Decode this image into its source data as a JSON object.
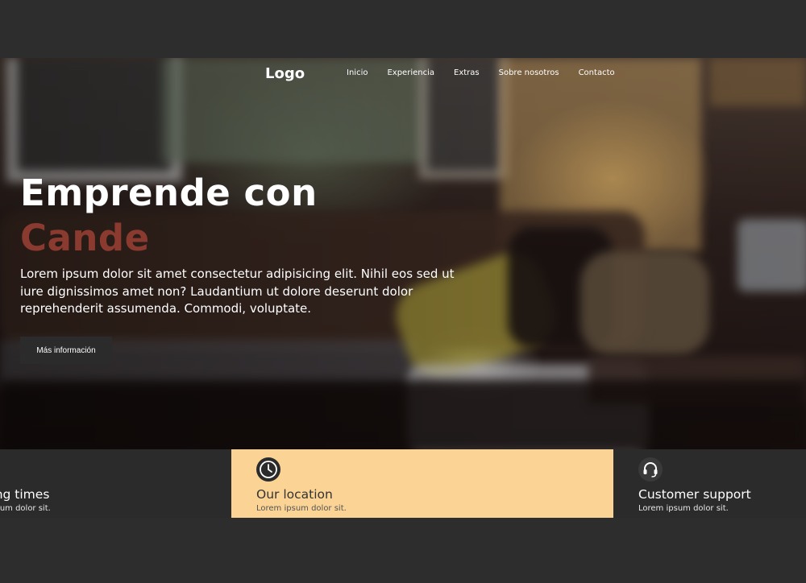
{
  "nav": {
    "logo": "Logo",
    "items": [
      "Inicio",
      "Experiencia",
      "Extras",
      "Sobre nosotros",
      "Contacto"
    ]
  },
  "hero": {
    "title_line1": "Emprende con",
    "title_line2": "Cande",
    "description": "Lorem ipsum dolor sit amet consectetur adipisicing elit. Nihil eos sed ut iure dignissimos amet non? Laudantium ut dolore deserunt dolor reprehenderit assumenda. Commodi, voluptate.",
    "cta_label": "Más información"
  },
  "features": [
    {
      "title": "Opening times",
      "subtitle": "Lorem ipsum dolor sit.",
      "icon": "clock-icon"
    },
    {
      "title": "Our location",
      "subtitle": "Lorem ipsum dolor sit.",
      "icon": "clock-icon"
    },
    {
      "title": "Customer support",
      "subtitle": "Lorem ipsum dolor sit.",
      "icon": "headset-icon"
    }
  ],
  "colors": {
    "accent": "#8b3a30",
    "highlight_card": "#fbd394",
    "dark": "#2b2b2b"
  }
}
